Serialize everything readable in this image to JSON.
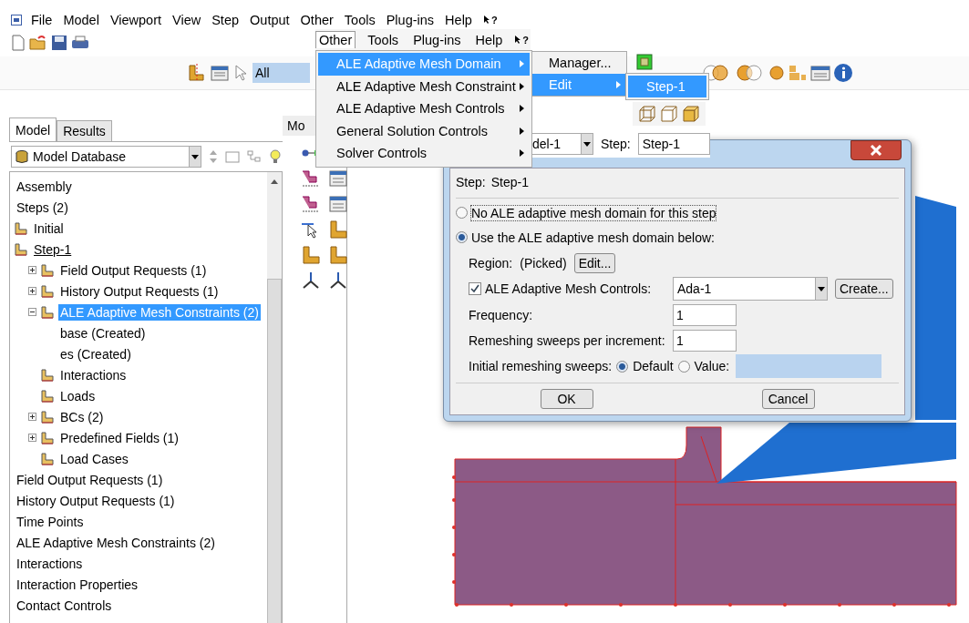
{
  "menubar": {
    "items": [
      "File",
      "Model",
      "Viewport",
      "View",
      "Step",
      "Output",
      "Other",
      "Tools",
      "Plug-ins",
      "Help"
    ],
    "help_button": "?"
  },
  "selection_filter": {
    "value": "All"
  },
  "left_panel": {
    "tabs": [
      {
        "label": "Model",
        "selected": true
      },
      {
        "label": "Results",
        "selected": false
      }
    ],
    "database": "Model Database",
    "tree": [
      {
        "label": "Assembly",
        "selected": false
      },
      {
        "label": "Steps (2)",
        "selected": false,
        "children": [
          {
            "label": "Initial",
            "selected": false,
            "current": false
          },
          {
            "label": "Step-1",
            "selected": false,
            "current": true,
            "children": [
              {
                "label": "Field Output Requests (1)",
                "selected": false,
                "expanded": false
              },
              {
                "label": "History Output Requests (1)",
                "selected": false,
                "expanded": false
              },
              {
                "label": "ALE Adaptive Mesh Constraints (2)",
                "selected": true,
                "expanded": true,
                "children": [
                  {
                    "label": "base (Created)",
                    "selected": false
                  },
                  {
                    "label": "es (Created)",
                    "selected": false
                  }
                ]
              },
              {
                "label": "Interactions",
                "selected": false
              },
              {
                "label": "Loads",
                "selected": false
              },
              {
                "label": "BCs (2)",
                "selected": false,
                "expanded": false
              },
              {
                "label": "Predefined Fields (1)",
                "selected": false,
                "expanded": false
              },
              {
                "label": "Load Cases",
                "selected": false
              }
            ]
          }
        ]
      },
      {
        "label": "Field Output Requests (1)",
        "selected": false
      },
      {
        "label": "History Output Requests (1)",
        "selected": false
      },
      {
        "label": "Time Points",
        "selected": false
      },
      {
        "label": "ALE Adaptive Mesh Constraints (2)",
        "selected": false
      },
      {
        "label": "Interactions",
        "selected": false
      },
      {
        "label": "Interaction Properties",
        "selected": false
      },
      {
        "label": "Contact Controls",
        "selected": false
      }
    ]
  },
  "toolbox": {
    "tab": "Mo"
  },
  "context_bar": {
    "model": "del-1",
    "step_label": "Step:",
    "step": "Step-1"
  },
  "menu_overlay": {
    "bar": [
      {
        "label": "Other",
        "selected": true
      },
      {
        "label": "Tools",
        "selected": false
      },
      {
        "label": "Plug-ins",
        "selected": false
      },
      {
        "label": "Help",
        "selected": false
      }
    ],
    "help_button": "?",
    "items": [
      {
        "label": "ALE Adaptive Mesh Domain",
        "selected": true
      },
      {
        "label": "ALE Adaptive Mesh Constraint",
        "selected": false
      },
      {
        "label": "ALE Adaptive Mesh Controls",
        "selected": false
      },
      {
        "label": "General Solution Controls",
        "selected": false
      },
      {
        "label": "Solver Controls",
        "selected": false
      }
    ],
    "submenu": [
      {
        "label": "Manager...",
        "selected": false,
        "has_submenu": false
      },
      {
        "label": "Edit",
        "selected": true,
        "has_submenu": true
      }
    ],
    "subsubmenu": [
      {
        "label": "Step-1",
        "selected": true
      }
    ]
  },
  "dialog": {
    "step_label": "Step:",
    "step": "Step-1",
    "options": [
      {
        "label": "No ALE adaptive mesh domain for this step",
        "selected": false
      },
      {
        "label": "Use the ALE adaptive mesh domain below:",
        "selected": true
      }
    ],
    "region_label": "Region:",
    "region_value": "(Picked)",
    "edit_button": "Edit...",
    "controls": {
      "label": "ALE Adaptive Mesh Controls:",
      "checked": true,
      "value": "Ada-1"
    },
    "create_button": "Create...",
    "fields": [
      {
        "label": "Frequency:",
        "value": "1"
      },
      {
        "label": "Remeshing sweeps per increment:",
        "value": "1"
      }
    ],
    "initial_sweeps": {
      "label": "Initial remeshing sweeps:",
      "options": [
        {
          "label": "Default",
          "selected": true
        },
        {
          "label": "Value:",
          "selected": false
        }
      ]
    },
    "buttons": [
      "OK",
      "Cancel"
    ]
  }
}
